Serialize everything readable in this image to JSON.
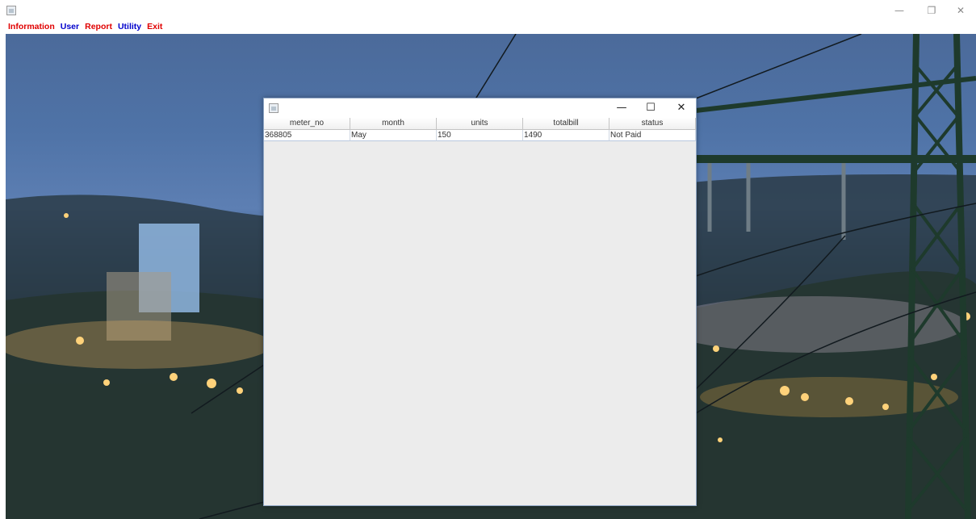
{
  "window": {
    "icon": "java-app-icon",
    "controls": {
      "minimize": "—",
      "restore": "❐",
      "close": "✕"
    }
  },
  "menu": {
    "items": [
      {
        "label": "Information",
        "color": "#e00000"
      },
      {
        "label": "User",
        "color": "#0000cc"
      },
      {
        "label": "Report",
        "color": "#e00000"
      },
      {
        "label": "Utility",
        "color": "#0000cc"
      },
      {
        "label": "Exit",
        "color": "#e00000"
      }
    ]
  },
  "dialog": {
    "icon": "java-app-icon",
    "controls": {
      "minimize": "—",
      "maximize": "☐",
      "close": "✕"
    },
    "table": {
      "columns": [
        "meter_no",
        "month",
        "units",
        "totalbill",
        "status"
      ],
      "rows": [
        [
          "368805",
          "May",
          "150",
          "1490",
          "Not Paid"
        ]
      ]
    }
  }
}
